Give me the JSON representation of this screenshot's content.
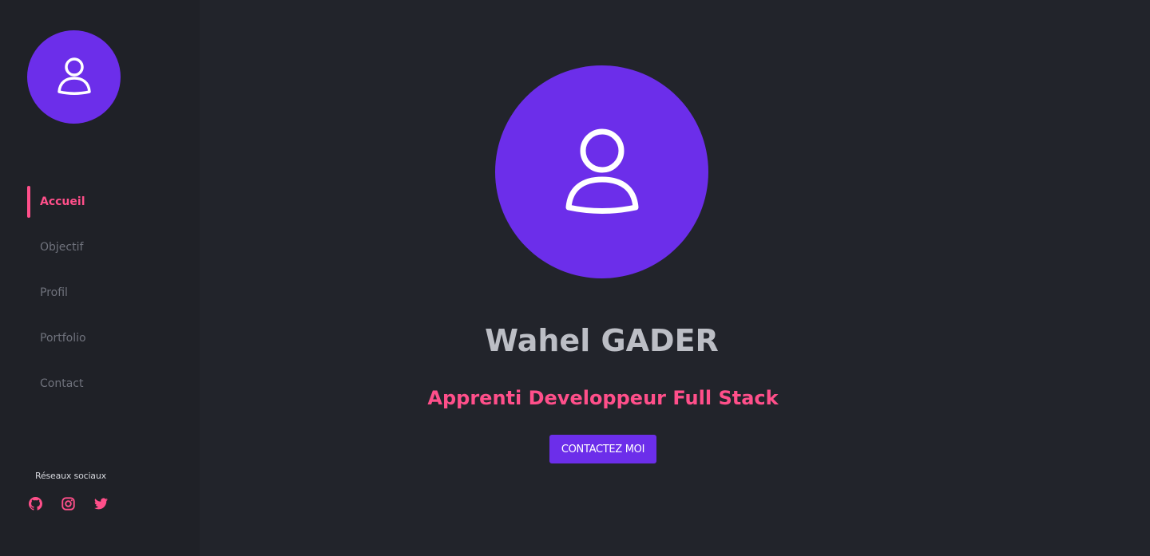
{
  "colors": {
    "accent": "#6c2eea",
    "highlight": "#ff4f8a",
    "background": "#22242b",
    "sidebar_background": "#1f2127"
  },
  "sidebar": {
    "avatar_icon": "user-icon",
    "nav": [
      {
        "label": "Accueil",
        "active": true
      },
      {
        "label": "Objectif",
        "active": false
      },
      {
        "label": "Profil",
        "active": false
      },
      {
        "label": "Portfolio",
        "active": false
      },
      {
        "label": "Contact",
        "active": false
      }
    ],
    "social": {
      "title": "Réseaux sociaux",
      "icons": [
        "github-icon",
        "instagram-icon",
        "twitter-icon"
      ]
    }
  },
  "hero": {
    "avatar_icon": "user-icon",
    "name": "Wahel GADER",
    "role": "Apprenti Developpeur Full Stack",
    "cta_label": "CONTACTEZ MOI"
  }
}
